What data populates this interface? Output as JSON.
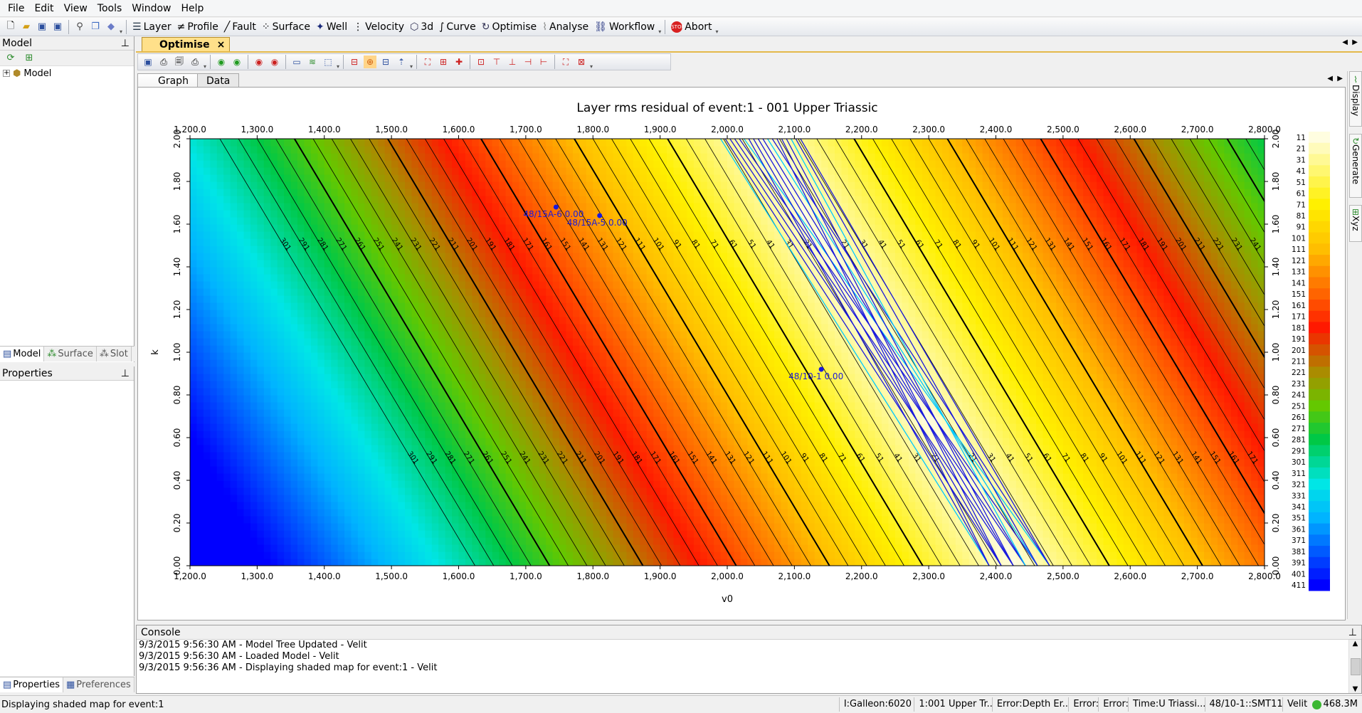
{
  "menu": [
    "File",
    "Edit",
    "View",
    "Tools",
    "Window",
    "Help"
  ],
  "toolbar": {
    "buttons": [
      "Layer",
      "Profile",
      "Fault",
      "Surface",
      "Well",
      "Velocity",
      "3d",
      "Curve",
      "Optimise",
      "Analyse",
      "Workflow",
      "Abort"
    ]
  },
  "model_panel": {
    "title": "Model",
    "tree_root": "Model"
  },
  "left_tabs": [
    "Model",
    "Surface",
    "Slot"
  ],
  "properties_panel": {
    "title": "Properties"
  },
  "props_tabs": [
    "Properties",
    "Preferences"
  ],
  "doc_tab": {
    "label": "Optimise",
    "close": "×"
  },
  "inner_tabs": [
    "Graph",
    "Data"
  ],
  "right_dock_tabs": [
    "Display",
    "Generate",
    "Xyz"
  ],
  "console": {
    "title": "Console",
    "lines": [
      "9/3/2015 9:56:30 AM - Model Tree Updated - Velit",
      "9/3/2015 9:56:30 AM - Loaded Model - Velit",
      "9/3/2015 9:56:36 AM - Displaying shaded map for event:1 - Velit"
    ]
  },
  "statusbar": {
    "message": "Displaying shaded map for event:1",
    "cells": [
      "I:Galleon:6020",
      "1:001 Upper Tr...",
      "Error:Depth Er...",
      "Error:",
      "Error:",
      "Time:U Triassi...",
      "48/10-1::SMT11...",
      "Velit"
    ],
    "memory": "468.3M"
  },
  "chart_data": {
    "type": "heatmap",
    "title": "Layer rms residual of event:1 - 001 Upper Triassic",
    "xlabel": "v0",
    "ylabel": "k",
    "xlim": [
      1200,
      2800
    ],
    "ylim": [
      0,
      2
    ],
    "x_ticks": [
      "1,200.0",
      "1,300.0",
      "1,400.0",
      "1,500.0",
      "1,600.0",
      "1,700.0",
      "1,800.0",
      "1,900.0",
      "2,000.0",
      "2,100.0",
      "2,200.0",
      "2,300.0",
      "2,400.0",
      "2,500.0",
      "2,600.0",
      "2,700.0",
      "2,800.0"
    ],
    "y_ticks": [
      "0.00",
      "0.20",
      "0.40",
      "0.60",
      "0.80",
      "1.00",
      "1.20",
      "1.40",
      "1.60",
      "1.80",
      "2.00"
    ],
    "colorbar": [
      "11",
      "21",
      "31",
      "41",
      "51",
      "61",
      "71",
      "81",
      "91",
      "101",
      "111",
      "121",
      "131",
      "141",
      "151",
      "161",
      "171",
      "181",
      "191",
      "201",
      "211",
      "221",
      "231",
      "241",
      "251",
      "261",
      "271",
      "281",
      "291",
      "301",
      "311",
      "321",
      "331",
      "341",
      "351",
      "361",
      "371",
      "381",
      "391",
      "401",
      "411"
    ],
    "colors": {
      "low": "#fffde0",
      "mid": "#ff1a00",
      "high": "#0000ff"
    },
    "well_labels": [
      "48/15A-6 0.00",
      "48/15A-5 0.00",
      "48/10-1 0.00"
    ],
    "grid": false
  }
}
